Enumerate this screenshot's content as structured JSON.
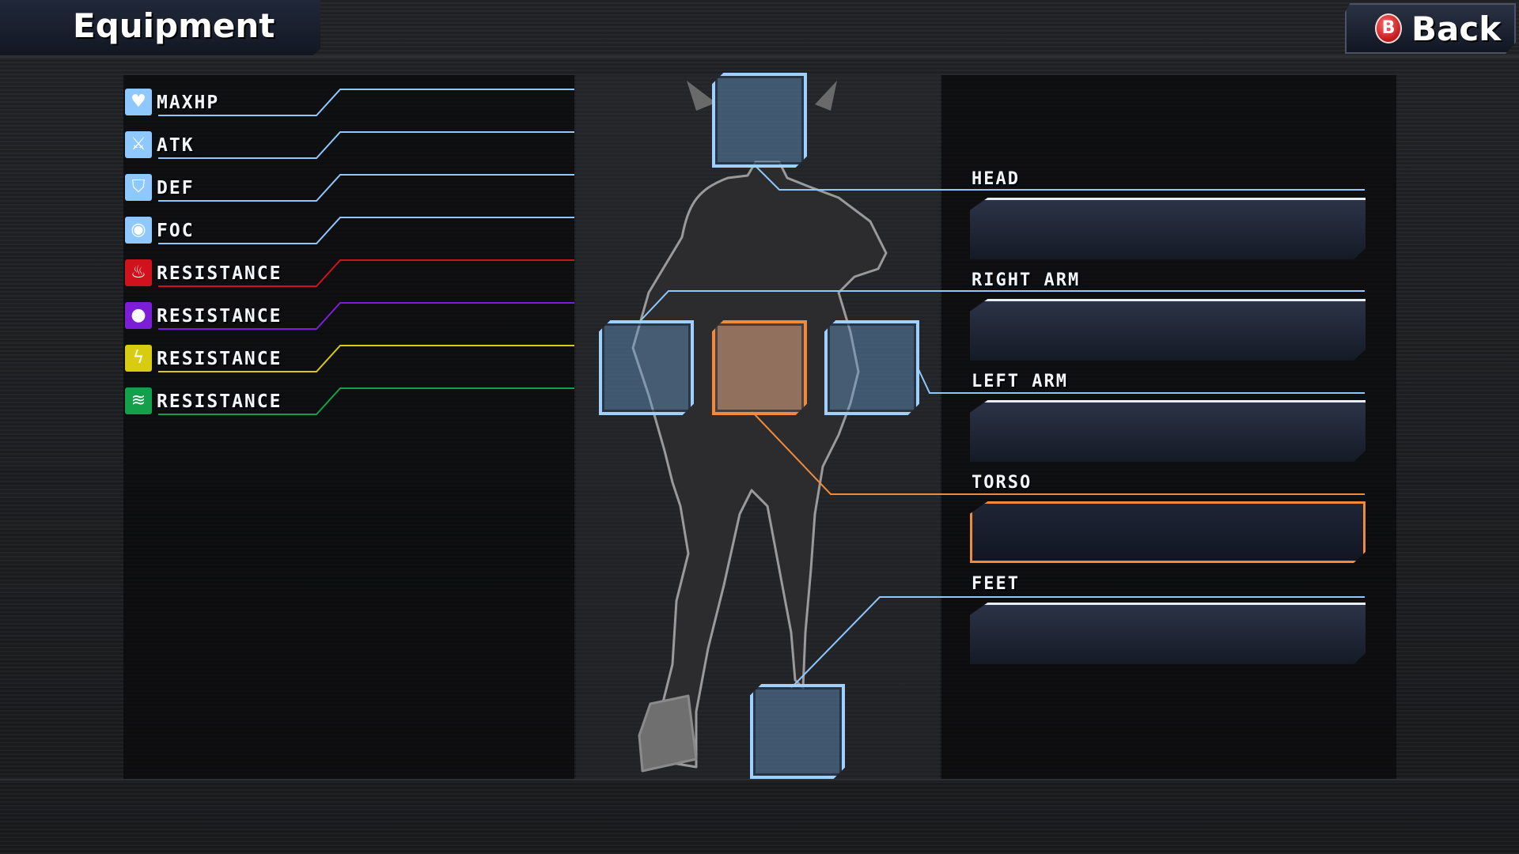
{
  "header": {
    "title": "Equipment"
  },
  "back_button": {
    "key_glyph": "B",
    "label": "Back"
  },
  "stats": [
    {
      "label": "MAXHP",
      "icon": "heart-icon",
      "color": "#8fc8ff",
      "glyph": "♥"
    },
    {
      "label": "ATK",
      "icon": "sword-icon",
      "color": "#8fc8ff",
      "glyph": "⚔"
    },
    {
      "label": "DEF",
      "icon": "shield-icon",
      "color": "#8fc8ff",
      "glyph": "⛉"
    },
    {
      "label": "FOC",
      "icon": "eye-icon",
      "color": "#8fc8ff",
      "glyph": "◉"
    },
    {
      "label": "RESISTANCE",
      "icon": "fire-icon",
      "color": "#d0121c",
      "glyph": "♨"
    },
    {
      "label": "RESISTANCE",
      "icon": "dark-orb-icon",
      "color": "#7a1ed8",
      "glyph": "●"
    },
    {
      "label": "RESISTANCE",
      "icon": "lightning-icon",
      "color": "#d8cc12",
      "glyph": "ϟ"
    },
    {
      "label": "RESISTANCE",
      "icon": "wind-icon",
      "color": "#14a04a",
      "glyph": "≋"
    }
  ],
  "slots": [
    {
      "label": "HEAD",
      "selected": false
    },
    {
      "label": "RIGHT ARM",
      "selected": false
    },
    {
      "label": "LEFT ARM",
      "selected": false
    },
    {
      "label": "TORSO",
      "selected": true
    },
    {
      "label": "FEET",
      "selected": false
    }
  ],
  "colors": {
    "accent_blue": "#9fd0ff",
    "accent_orange": "#f08a3c"
  }
}
